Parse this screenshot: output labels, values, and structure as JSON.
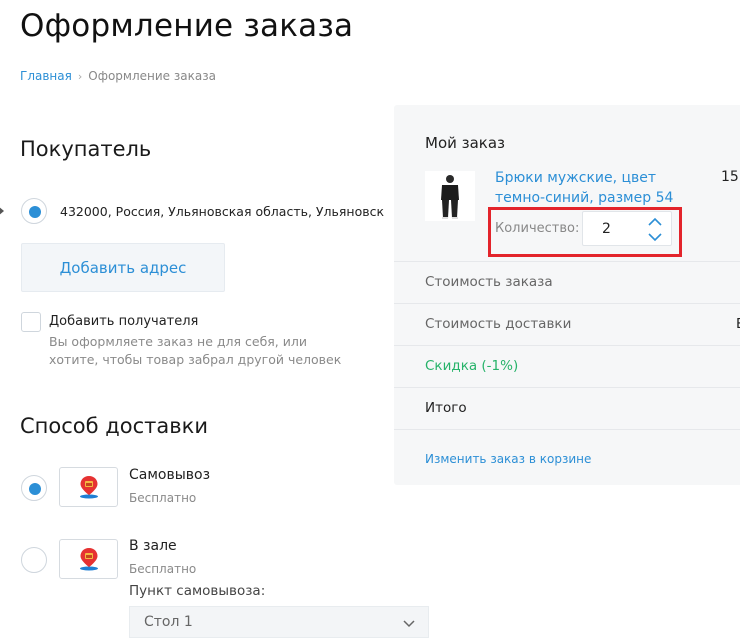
{
  "page": {
    "title": "Оформление заказа"
  },
  "breadcrumb": {
    "home": "Главная",
    "current": "Оформление заказа"
  },
  "buyer": {
    "title": "Покупатель",
    "address": "432000, Россия, Ульяновская область, Ульяновск",
    "add_address_label": "Добавить адрес",
    "add_recipient_label": "Добавить получателя",
    "add_recipient_hint": "Вы оформляете заказ не для себя, или хотите, чтобы товар забрал другой человек"
  },
  "delivery": {
    "title": "Способ доставки",
    "options": [
      {
        "name": "Самовывоз",
        "price": "Бесплатно",
        "selected": true
      },
      {
        "name": "В зале",
        "price": "Бесплатно",
        "selected": false
      }
    ],
    "pickup_point_label": "Пункт самовывоза:",
    "pickup_point_value": "Стол 1"
  },
  "order": {
    "title": "Мой заказ",
    "product": {
      "name": "Брюки мужские, цвет темно-синий, размер 54",
      "price_partial": "15",
      "quantity_label": "Количество:",
      "quantity": "2"
    },
    "summary": [
      {
        "label": "Стоимость заказа",
        "value": ""
      },
      {
        "label": "Стоимость доставки",
        "value": "Б"
      },
      {
        "label": "Скидка (-1%)",
        "value": ""
      },
      {
        "label": "Итого",
        "value": ""
      }
    ],
    "edit_link": "Изменить заказ в корзине"
  },
  "colors": {
    "accent": "#2c8fd6",
    "discount": "#27b36a",
    "highlight": "#e3242b"
  },
  "icons": {
    "delivery": "map-pin-store-icon",
    "qty_up": "chevron-up-icon",
    "qty_down": "chevron-down-icon",
    "select": "chevron-down-icon"
  }
}
